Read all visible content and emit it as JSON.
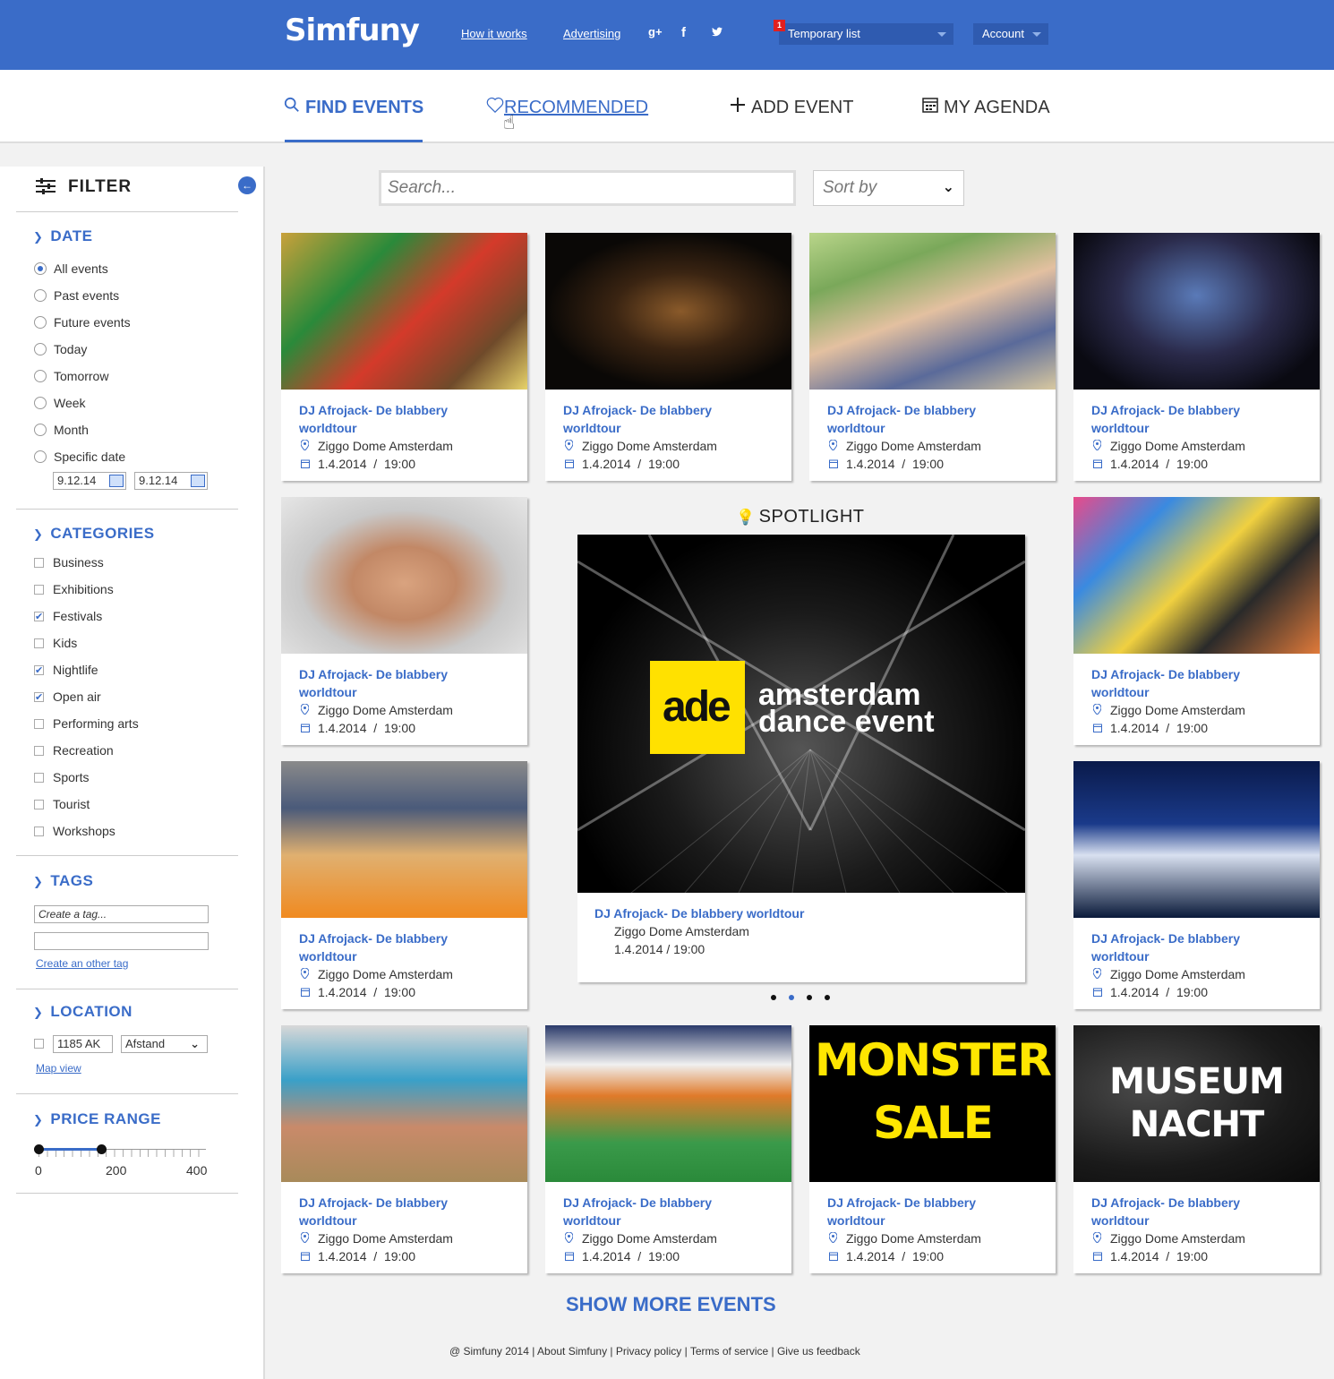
{
  "header": {
    "logo": "Simfuny",
    "links": [
      "How it works",
      "Advertising"
    ],
    "social": [
      "g+",
      "f",
      "twitter"
    ],
    "list_badge": "1",
    "list_label": "Temporary list",
    "account_label": "Account"
  },
  "nav": {
    "find": "FIND EVENTS",
    "recommended": "RECOMMENDED",
    "add": "ADD EVENT",
    "agenda": "MY AGENDA"
  },
  "filter": {
    "title": "FILTER",
    "date": {
      "title": "DATE",
      "options": [
        "All events",
        "Past events",
        "Future events",
        "Today",
        "Tomorrow",
        "Week",
        "Month",
        "Specific date"
      ],
      "selected": "All events",
      "from": "9.12.14",
      "to": "9.12.14"
    },
    "categories": {
      "title": "CATEGORIES",
      "items": [
        "Business",
        "Exhibitions",
        "Festivals",
        "Kids",
        "Nightlife",
        "Open air",
        "Performing arts",
        "Recreation",
        "Sports",
        "Tourist",
        "Workshops"
      ],
      "checked": [
        "Festivals",
        "Nightlife",
        "Open air"
      ]
    },
    "tags": {
      "title": "TAGS",
      "placeholder": "Create a tag...",
      "add_link": "Create an other tag"
    },
    "location": {
      "title": "LOCATION",
      "postcode": "1185 AK",
      "distance": "Afstand",
      "map_link": "Map view"
    },
    "price": {
      "title": "PRICE RANGE",
      "labels": [
        "0",
        "200",
        "400"
      ],
      "selected_min": 0,
      "selected_max": 150,
      "max": 400
    }
  },
  "search": {
    "placeholder": "Search...",
    "sort": "Sort by"
  },
  "event": {
    "title": "DJ Afrojack- De blabbery worldtour",
    "place": "Ziggo Dome Amsterdam",
    "date": "1.4.2014",
    "time": "19:00",
    "when": "1.4.2014  /  19:00"
  },
  "spotlight": {
    "title": "SPOTLIGHT",
    "logo_text": "ade",
    "brand_line1": "amsterdam",
    "brand_line2": "dance event",
    "event_title": "DJ Afrojack- De blabbery worldtour",
    "place": "Ziggo Dome Amsterdam",
    "when": "1.4.2014  /  19:00",
    "dots": 4,
    "active_dot": 2
  },
  "posters": {
    "monster_1": "MONSTER",
    "monster_2": "SALE",
    "museum_1": "MUSEUM",
    "museum_2": "NACHT"
  },
  "show_more": "SHOW MORE EVENTS",
  "footer": {
    "copyright": "@ Simfuny 2014",
    "links": [
      "About Simfuny",
      "Privacy policy",
      "Terms of service",
      "Give us feedback"
    ]
  }
}
